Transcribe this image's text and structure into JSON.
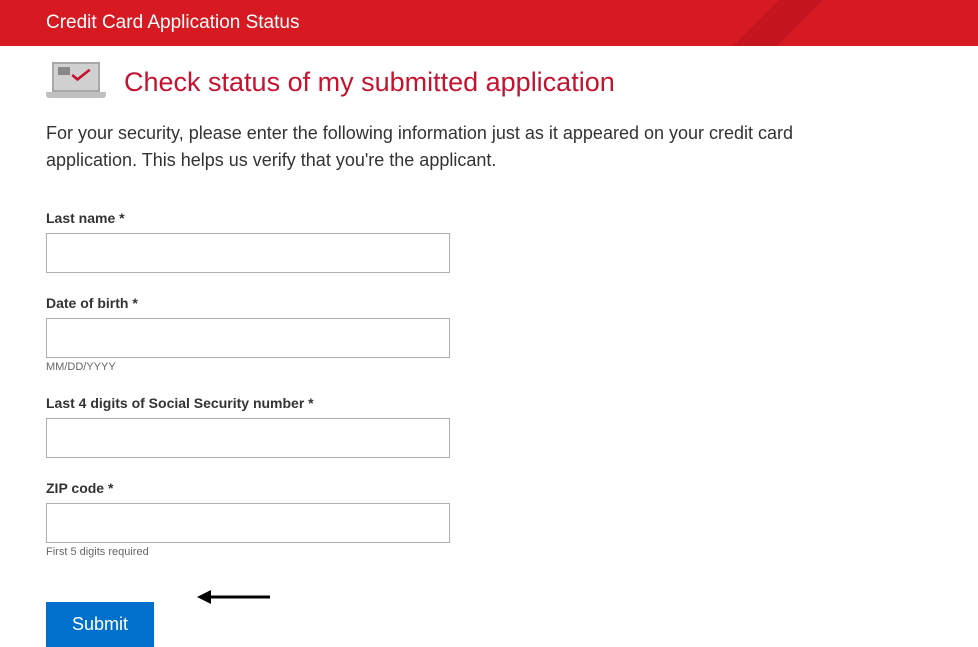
{
  "header": {
    "title": "Credit Card Application Status"
  },
  "page": {
    "heading": "Check status of my submitted application",
    "intro": "For your security, please enter the following information just as it appeared on your credit card application. This helps us verify that you're the applicant."
  },
  "form": {
    "last_name": {
      "label": "Last name *",
      "value": ""
    },
    "dob": {
      "label": "Date of birth *",
      "value": "",
      "hint": "MM/DD/YYYY"
    },
    "ssn": {
      "label": "Last 4 digits of Social Security number *",
      "value": ""
    },
    "zip": {
      "label": "ZIP code *",
      "value": "",
      "hint": "First 5 digits required"
    },
    "submit_label": "Submit"
  }
}
